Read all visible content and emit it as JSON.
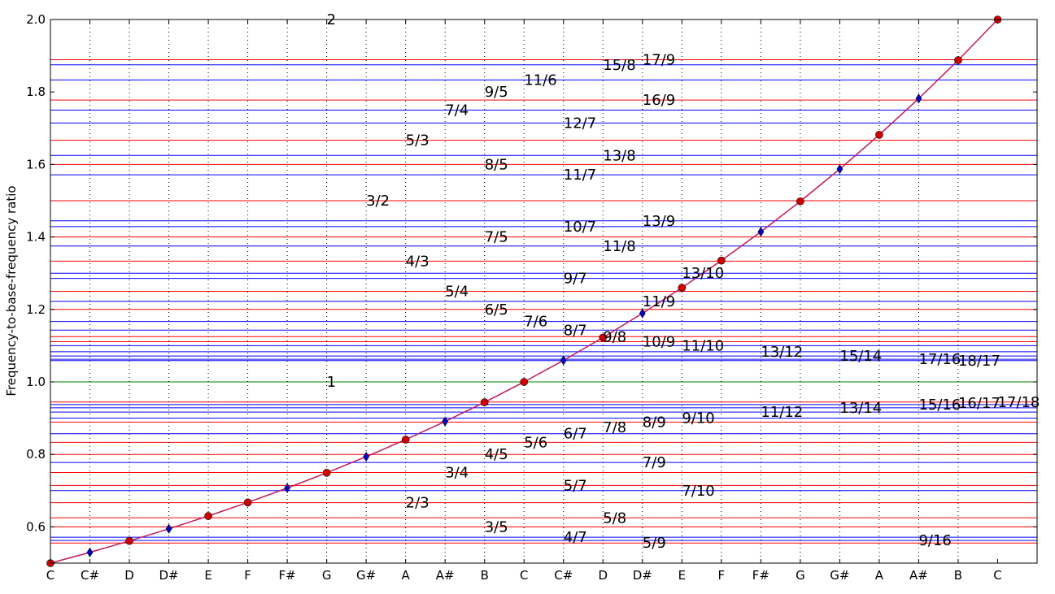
{
  "chart_data": {
    "type": "line",
    "title": "",
    "xlabel": "",
    "ylabel": "Frequency-to-base-frequency ratio",
    "ylim": [
      0.5,
      2.0
    ],
    "xlim": [
      0,
      25
    ],
    "grid": {
      "x": "dotted",
      "y": false
    },
    "x_tick_labels": [
      "C",
      "C#",
      "D",
      "D#",
      "E",
      "F",
      "F#",
      "G",
      "G#",
      "A",
      "A#",
      "B",
      "C",
      "C#",
      "D",
      "D#",
      "E",
      "F",
      "F#",
      "G",
      "G#",
      "A",
      "A#",
      "B",
      "C"
    ],
    "y_ticks": [
      0.6,
      0.8,
      1.0,
      1.2,
      1.4,
      1.6,
      1.8,
      2.0
    ],
    "y_tick_labels": [
      "0.6",
      "0.8",
      "1.0",
      "1.2",
      "1.4",
      "1.6",
      "1.8",
      "2.0"
    ],
    "series": [
      {
        "color": "#d40000",
        "marker": "circle",
        "x": [
          0,
          2,
          4,
          5,
          7,
          9,
          11,
          12,
          14,
          16,
          17,
          19,
          21,
          23,
          24
        ],
        "y": [
          0.5,
          0.5612,
          0.63,
          0.6674,
          0.7492,
          0.8409,
          0.9439,
          1.0,
          1.1225,
          1.2599,
          1.3348,
          1.4983,
          1.6818,
          1.8877,
          2.0
        ]
      },
      {
        "color": "#0000cc",
        "marker": "diamond",
        "x": [
          1,
          3,
          6,
          8,
          10,
          13,
          15,
          18,
          20,
          22
        ],
        "y": [
          0.5297,
          0.5946,
          0.7071,
          0.7937,
          0.8909,
          1.0595,
          1.1892,
          1.4142,
          1.5874,
          1.7818
        ]
      }
    ],
    "line_color": "#c2185b",
    "hlines": {
      "red_color": "#ff0000",
      "blue_color": "#0000ff",
      "green_color": "#008000",
      "green": [
        1.0
      ],
      "red": [
        1.8889,
        1.7778,
        1.6667,
        1.6,
        1.5,
        1.4,
        1.3333,
        1.25,
        1.2,
        1.125,
        1.1111,
        0.9444,
        0.8889,
        0.8333,
        0.8,
        0.75,
        0.7143,
        0.6667,
        0.625,
        0.6,
        0.5556
      ],
      "blue": [
        1.875,
        1.8333,
        1.75,
        1.7143,
        1.625,
        1.5714,
        1.4444,
        1.4286,
        1.375,
        1.2857,
        1.3,
        1.2222,
        1.1667,
        1.1429,
        1.1,
        1.0833,
        1.0714,
        1.0625,
        1.0588,
        0.9375,
        0.9286,
        0.9167,
        0.9,
        0.8571,
        0.7778,
        0.7,
        0.5714,
        0.5625
      ]
    },
    "annotations": [
      {
        "text": "2",
        "x": 7,
        "y": 2.0
      },
      {
        "text": "1",
        "x": 7,
        "y": 1.0
      },
      {
        "text": "3/2",
        "x": 8,
        "y": 1.5
      },
      {
        "text": "5/3",
        "x": 9,
        "y": 1.6667
      },
      {
        "text": "4/3",
        "x": 9,
        "y": 1.3333
      },
      {
        "text": "2/3",
        "x": 9,
        "y": 0.6667
      },
      {
        "text": "7/4",
        "x": 10,
        "y": 1.75
      },
      {
        "text": "5/4",
        "x": 10,
        "y": 1.25
      },
      {
        "text": "3/4",
        "x": 10,
        "y": 0.75
      },
      {
        "text": "9/5",
        "x": 11,
        "y": 1.8
      },
      {
        "text": "8/5",
        "x": 11,
        "y": 1.6
      },
      {
        "text": "7/5",
        "x": 11,
        "y": 1.4
      },
      {
        "text": "6/5",
        "x": 11,
        "y": 1.2
      },
      {
        "text": "4/5",
        "x": 11,
        "y": 0.8
      },
      {
        "text": "3/5",
        "x": 11,
        "y": 0.6
      },
      {
        "text": "11/6",
        "x": 12,
        "y": 1.8333
      },
      {
        "text": "7/6",
        "x": 12,
        "y": 1.1667
      },
      {
        "text": "5/6",
        "x": 12,
        "y": 0.8333
      },
      {
        "text": "12/7",
        "x": 13,
        "y": 1.7143
      },
      {
        "text": "11/7",
        "x": 13,
        "y": 1.5714
      },
      {
        "text": "10/7",
        "x": 13,
        "y": 1.4286
      },
      {
        "text": "9/7",
        "x": 13,
        "y": 1.2857
      },
      {
        "text": "8/7",
        "x": 13,
        "y": 1.1429
      },
      {
        "text": "6/7",
        "x": 13,
        "y": 0.8571
      },
      {
        "text": "5/7",
        "x": 13,
        "y": 0.7143
      },
      {
        "text": "4/7",
        "x": 13,
        "y": 0.5714
      },
      {
        "text": "15/8",
        "x": 14,
        "y": 1.875
      },
      {
        "text": "13/8",
        "x": 14,
        "y": 1.625
      },
      {
        "text": "11/8",
        "x": 14,
        "y": 1.375
      },
      {
        "text": "9/8",
        "x": 14,
        "y": 1.125
      },
      {
        "text": "7/8",
        "x": 14,
        "y": 0.875
      },
      {
        "text": "5/8",
        "x": 14,
        "y": 0.625
      },
      {
        "text": "17/9",
        "x": 15,
        "y": 1.8889
      },
      {
        "text": "16/9",
        "x": 15,
        "y": 1.7778
      },
      {
        "text": "13/9",
        "x": 15,
        "y": 1.4444
      },
      {
        "text": "11/9",
        "x": 15,
        "y": 1.2222
      },
      {
        "text": "10/9",
        "x": 15,
        "y": 1.1111
      },
      {
        "text": "8/9",
        "x": 15,
        "y": 0.8889
      },
      {
        "text": "7/9",
        "x": 15,
        "y": 0.7778
      },
      {
        "text": "5/9",
        "x": 15,
        "y": 0.5556
      },
      {
        "text": "13/10",
        "x": 16,
        "y": 1.3
      },
      {
        "text": "11/10",
        "x": 16,
        "y": 1.1
      },
      {
        "text": "9/10",
        "x": 16,
        "y": 0.9
      },
      {
        "text": "7/10",
        "x": 16,
        "y": 0.7
      },
      {
        "text": "13/12",
        "x": 18,
        "y": 1.0833
      },
      {
        "text": "11/12",
        "x": 18,
        "y": 0.9167
      },
      {
        "text": "15/14",
        "x": 20,
        "y": 1.0714
      },
      {
        "text": "13/14",
        "x": 20,
        "y": 0.9286
      },
      {
        "text": "17/16",
        "x": 22,
        "y": 1.0625
      },
      {
        "text": "15/16",
        "x": 22,
        "y": 0.9375
      },
      {
        "text": "9/16",
        "x": 22,
        "y": 0.5625
      },
      {
        "text": "18/17",
        "x": 23,
        "y": 1.0588
      },
      {
        "text": "16/17",
        "x": 23,
        "y": 0.9412
      },
      {
        "text": "17/18",
        "x": 24,
        "y": 0.9444
      }
    ]
  }
}
